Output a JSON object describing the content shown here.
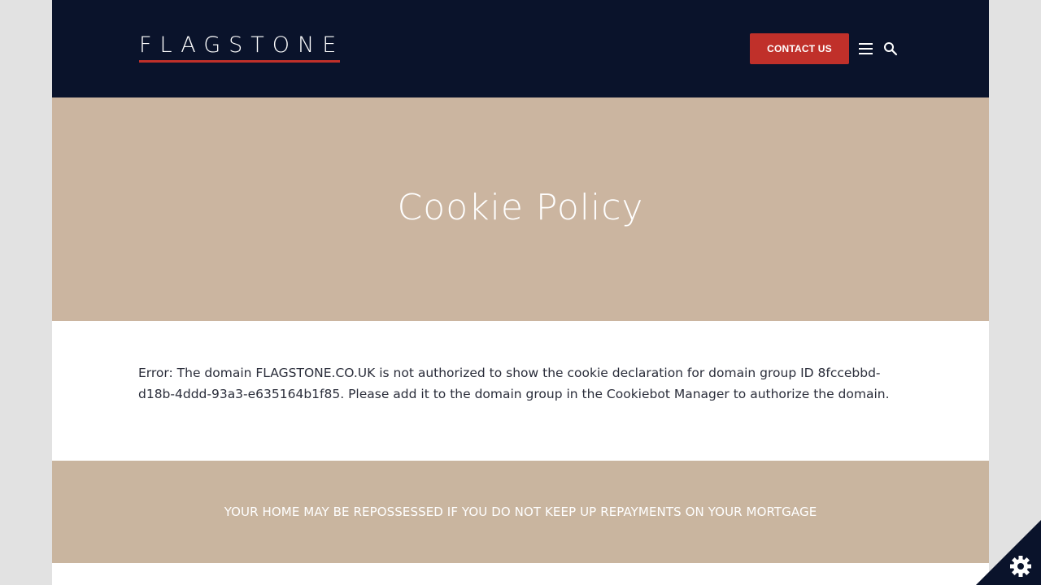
{
  "header": {
    "logo_text": "FLAGSTONE",
    "contact_label": "CONTACT US",
    "menu_icon": "hamburger-menu-icon",
    "search_icon": "search-icon"
  },
  "hero": {
    "title": "Cookie Policy"
  },
  "content": {
    "error_message": "Error: The domain FLAGSTONE.CO.UK is not authorized to show the cookie declaration for domain group ID 8fccebbd-d18b-4ddd-93a3-e635164b1f85. Please add it to the domain group in the Cookiebot Manager to authorize the domain."
  },
  "warning": {
    "text": "YOUR HOME MAY BE REPOSSESSED IF YOU DO NOT KEEP UP REPAYMENTS ON YOUR MORTGAGE"
  },
  "cookie_widget": {
    "icon": "gear-icon"
  },
  "colors": {
    "header_bg": "#0a132b",
    "accent_red": "#c0302a",
    "hero_bg": "#cbb5a0",
    "band_bg": "#c9b59f",
    "page_bg": "#e2e2e2"
  }
}
